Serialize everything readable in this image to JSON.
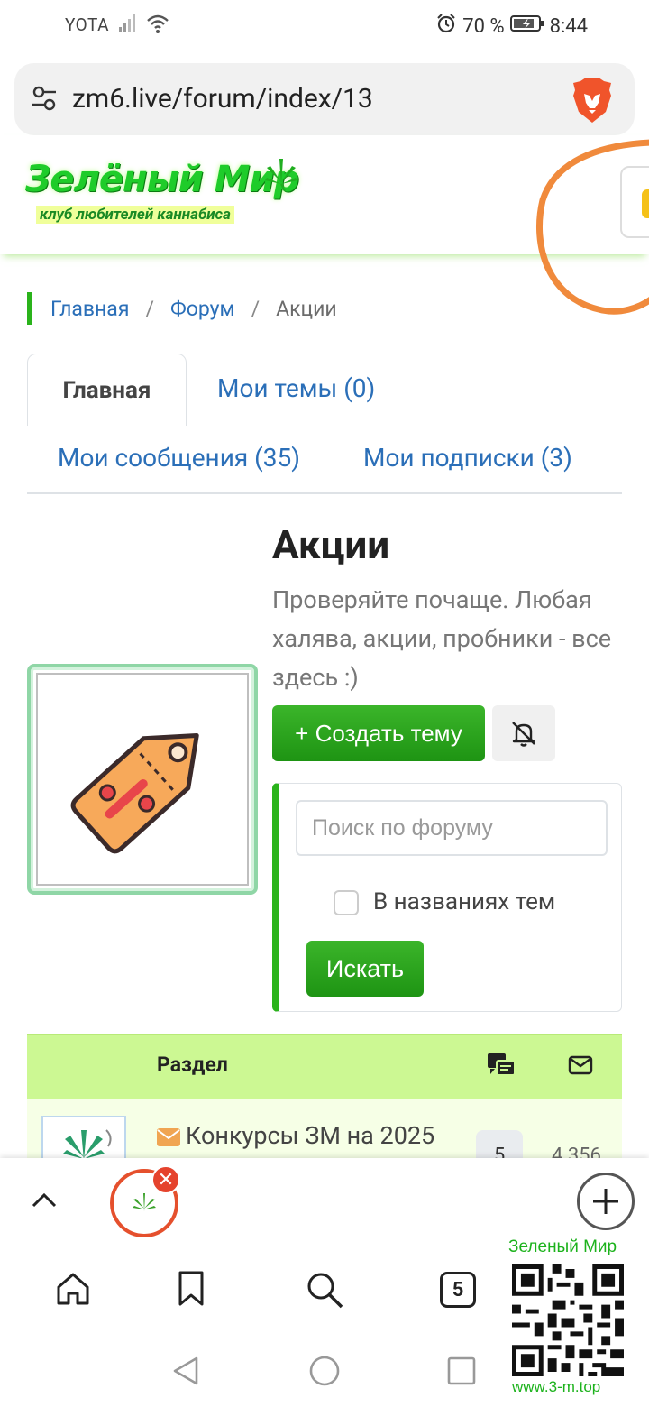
{
  "status_bar": {
    "carrier": "YOTA",
    "battery": "70 %",
    "time": "8:44"
  },
  "browser": {
    "url": "zm6.live/forum/index/13",
    "open_tabs": "5"
  },
  "site": {
    "logo_title": "Зелёный Мир",
    "logo_subtitle": "клуб любителей каннабиса"
  },
  "breadcrumb": {
    "home": "Главная",
    "forum": "Форум",
    "current": "Акции"
  },
  "tabs": {
    "main": "Главная",
    "my_topics": "Мои темы (0)",
    "my_messages": "Мои сообщения (35)",
    "my_subscriptions": "Мои подписки (3)"
  },
  "forum": {
    "title": "Акции",
    "description": "Проверяйте почаще. Любая халява, акции, пробники - все здесь :)",
    "create_button": "+ Создать тему"
  },
  "search": {
    "placeholder": "Поиск по форуму",
    "checkbox_label": "В названиях тем",
    "button": "Искать"
  },
  "table": {
    "header_title": "Раздел",
    "rows": [
      {
        "name": "Конкурсы ЗМ на 2025",
        "topics": "5",
        "messages": "4 356"
      }
    ]
  },
  "watermark": {
    "top": "Зеленый Мир",
    "bottom": "www.3-m.top"
  },
  "colors": {
    "accent_green": "#2ab31b",
    "link_blue": "#2b6fb8",
    "table_header": "#ccf893",
    "annotation_orange": "#f08a3c"
  }
}
